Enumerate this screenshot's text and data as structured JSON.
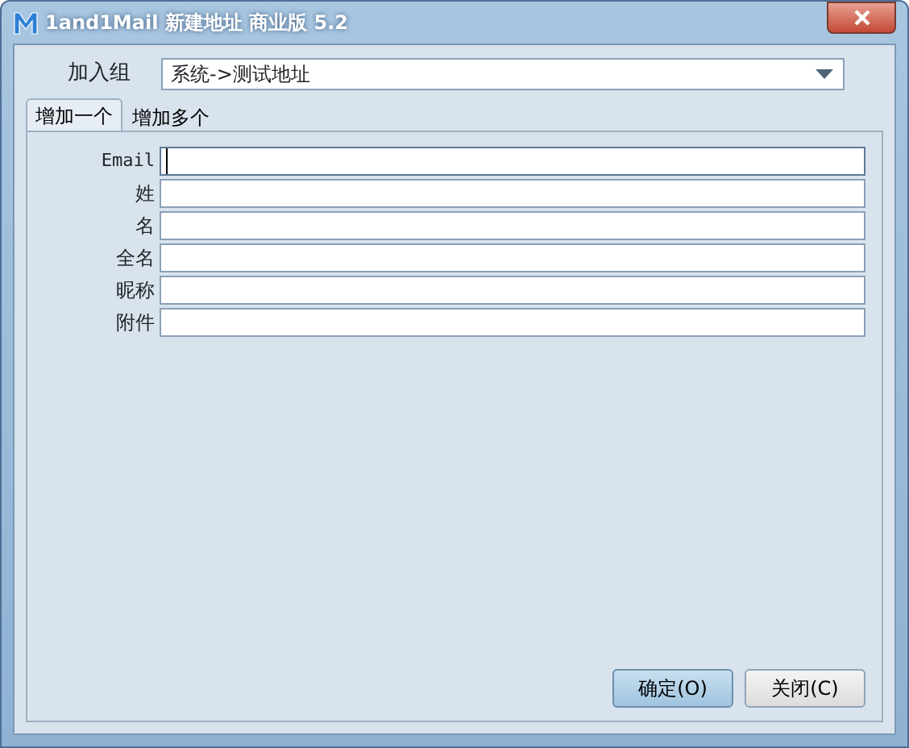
{
  "window": {
    "title": "1and1Mail 新建地址 商业版 5.2"
  },
  "group": {
    "label": "加入组",
    "value": "系统->测试地址"
  },
  "tabs": [
    {
      "label": "增加一个",
      "selected": true
    },
    {
      "label": "增加多个",
      "selected": false
    }
  ],
  "fields": [
    {
      "label": "Email",
      "focused": true
    },
    {
      "label": "姓",
      "focused": false
    },
    {
      "label": "名",
      "focused": false
    },
    {
      "label": "全名",
      "focused": false
    },
    {
      "label": "昵称",
      "focused": false
    },
    {
      "label": "附件",
      "focused": false
    }
  ],
  "buttons": [
    {
      "label": "确定(O)",
      "default": true
    },
    {
      "label": "关闭(C)",
      "default": false
    }
  ]
}
